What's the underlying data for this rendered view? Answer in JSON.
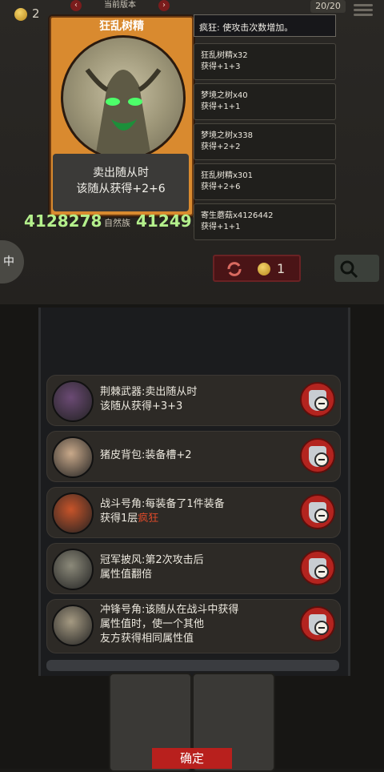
{
  "header": {
    "coins": "2",
    "version_label": "当前版本",
    "hp_badge": "20/20"
  },
  "card": {
    "name": "狂乱树精",
    "stars": "★★★★",
    "description_line1": "卖出随从时",
    "description_line2": "该随从获得+2+6",
    "attack": "4128278",
    "tribe": "自然族",
    "health": "412491"
  },
  "log": {
    "header": "疯狂: 使攻击次数增加。",
    "items": [
      {
        "title": "狂乱树精x32",
        "gain": "获得+1+3"
      },
      {
        "title": "梦境之树x40",
        "gain": "获得+1+1"
      },
      {
        "title": "梦境之树x338",
        "gain": "获得+2+2"
      },
      {
        "title": "狂乱树精x301",
        "gain": "获得+2+6"
      },
      {
        "title": "寄生蘑菇x4126442",
        "gain": "获得+1+1"
      }
    ]
  },
  "controls": {
    "left_pill": "中",
    "refresh_cost": "1"
  },
  "equipment": [
    {
      "line1": "荆棘武器:卖出随从时",
      "line2": "该随从获得+3+3",
      "line3": "",
      "icon": "thorn-weapon-icon",
      "color": "#6b4a74"
    },
    {
      "line1": "猪皮背包:装备槽+2",
      "line2": "",
      "line3": "",
      "icon": "pigskin-backpack-icon",
      "color": "#c9a98a"
    },
    {
      "line1": "战斗号角:每装备了1件装备",
      "line2": "获得1层",
      "line2_em": "疯狂",
      "line3": "",
      "icon": "battle-horn-icon",
      "color": "#c7542a"
    },
    {
      "line1": "冠军披风:第2次攻击后",
      "line2": "属性值翻倍",
      "line3": "",
      "icon": "champion-cape-icon",
      "color": "#8c8a7a"
    },
    {
      "line1": "冲锋号角:该随从在战斗中获得",
      "line2": "属性值时，使一个其他",
      "line3": "友方获得相同属性值",
      "icon": "charge-horn-icon",
      "color": "#a59a82"
    }
  ],
  "confirm_label": "确定"
}
